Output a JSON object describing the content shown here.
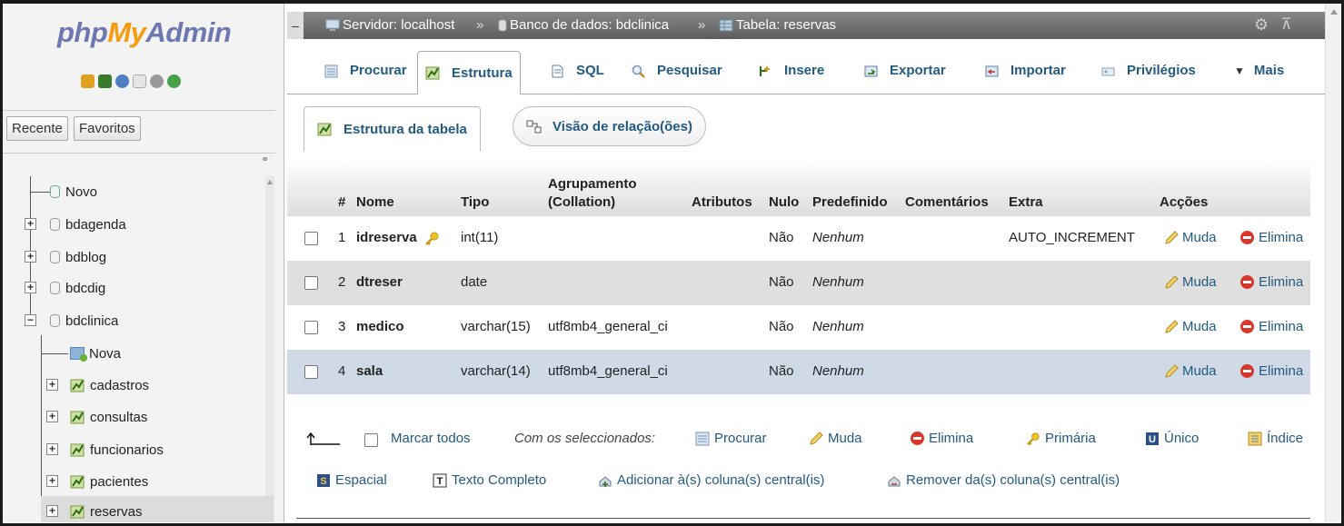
{
  "sidebar": {
    "logo": {
      "php": "php",
      "my": "My",
      "admin": "Admin"
    },
    "tabs": [
      "Recente",
      "Favoritos"
    ],
    "tree": [
      {
        "label": "Novo"
      },
      {
        "label": "bdagenda"
      },
      {
        "label": "bdblog"
      },
      {
        "label": "bdcdig"
      },
      {
        "label": "bdclinica"
      },
      {
        "label": "Nova"
      },
      {
        "label": "cadastros"
      },
      {
        "label": "consultas"
      },
      {
        "label": "funcionarios"
      },
      {
        "label": "pacientes"
      },
      {
        "label": "reservas"
      }
    ]
  },
  "breadcrumb": {
    "server": "Servidor: localhost",
    "sep1": "»",
    "database": "Banco de dados: bdclinica",
    "sep2": "»",
    "table": "Tabela: reservas"
  },
  "menu": [
    "Procurar",
    "Estrutura",
    "SQL",
    "Pesquisar",
    "Insere",
    "Exportar",
    "Importar",
    "Privilégios",
    "Mais"
  ],
  "subtabs": [
    "Estrutura da tabela",
    "Visão de relação(ões)"
  ],
  "table": {
    "headers": {
      "num": "#",
      "name": "Nome",
      "type": "Tipo",
      "collation1": "Agrupamento",
      "collation2": "(Collation)",
      "attributes": "Atributos",
      "null": "Nulo",
      "default": "Predefinido",
      "comments": "Comentários",
      "extra": "Extra",
      "actions": "Acções"
    },
    "rows": [
      {
        "num": "1",
        "name": "idreserva",
        "type": "int(11)",
        "collation": "",
        "null": "Não",
        "default": "Nenhum",
        "extra": "AUTO_INCREMENT",
        "primary": true
      },
      {
        "num": "2",
        "name": "dtreser",
        "type": "date",
        "collation": "",
        "null": "Não",
        "default": "Nenhum",
        "extra": "",
        "primary": false
      },
      {
        "num": "3",
        "name": "medico",
        "type": "varchar(15)",
        "collation": "utf8mb4_general_ci",
        "null": "Não",
        "default": "Nenhum",
        "extra": "",
        "primary": false
      },
      {
        "num": "4",
        "name": "sala",
        "type": "varchar(14)",
        "collation": "utf8mb4_general_ci",
        "null": "Não",
        "default": "Nenhum",
        "extra": "",
        "primary": false
      }
    ],
    "action_change": "Muda",
    "action_drop": "Elimina"
  },
  "footer": {
    "check_all": "Marcar todos",
    "with_selected": "Com os seleccionados:",
    "row1": [
      "Procurar",
      "Muda",
      "Elimina",
      "Primária",
      "Único",
      "Índice"
    ],
    "row2": [
      "Espacial",
      "Texto Completo",
      "Adicionar à(s) coluna(s) central(is)",
      "Remover da(s) coluna(s) central(is)"
    ]
  },
  "colors": {
    "link": "#235a81",
    "logo_blue": "#6c78af",
    "logo_orange": "#f89c0e",
    "drop_red": "#d9372b"
  }
}
